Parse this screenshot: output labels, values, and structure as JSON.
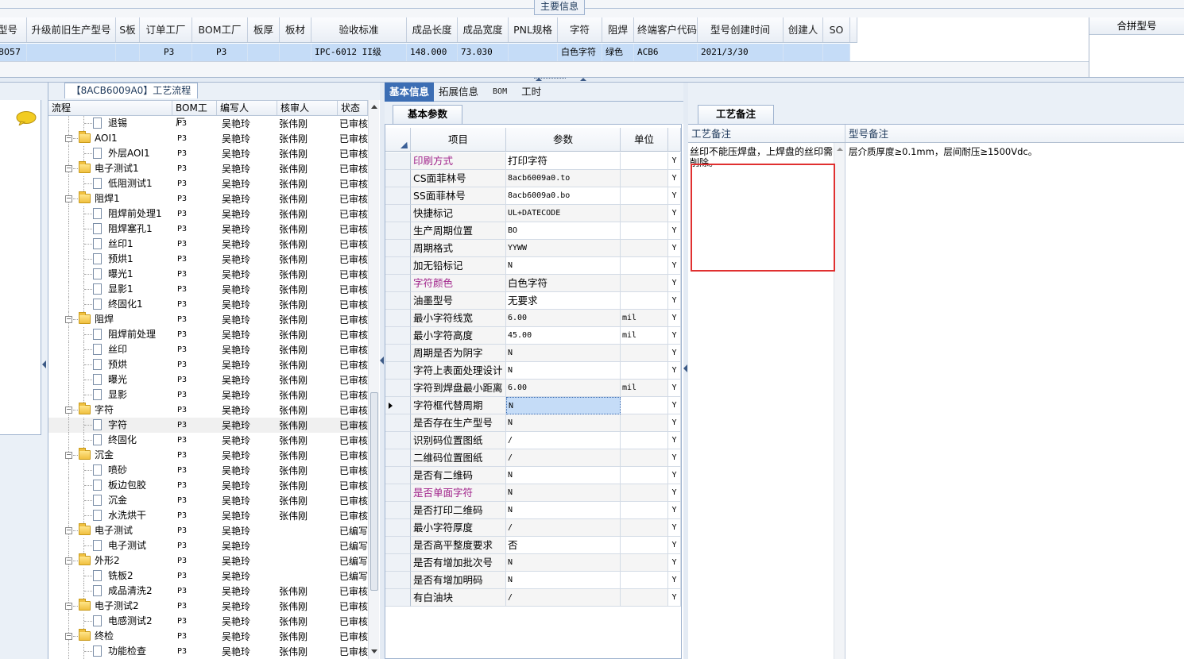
{
  "top": {
    "title": "主要信息",
    "columns": [
      "型号",
      "升级前旧生产型号",
      "S板",
      "订单工厂",
      "BOM工厂",
      "板厚",
      "板材",
      "验收标准",
      "成品长度",
      "成品宽度",
      "PNL规格",
      "字符",
      "阻焊",
      "终端客户代码",
      "型号创建时间",
      "创建人",
      "SO"
    ],
    "row": [
      "8057",
      "",
      "",
      "P3",
      "P3",
      "",
      "",
      "IPC-6012 II级",
      "148.000",
      "73.030",
      "",
      "白色字符",
      "绿色",
      "ACB6",
      "2021/3/30",
      "",
      ""
    ],
    "merge_header": "合拼型号"
  },
  "tree": {
    "title": "【8ACB6009A0】工艺流程",
    "columns": [
      "流程",
      "BOM工厂",
      "编写人",
      "核审人",
      "状态"
    ],
    "rows": [
      {
        "level": 1,
        "type": "doc",
        "name": "退锡",
        "factory": "P3",
        "writer": "吴艳玲",
        "reviewer": "张伟刚",
        "status": "已审核"
      },
      {
        "level": 0,
        "type": "folder",
        "name": "AOI1",
        "factory": "P3",
        "writer": "吴艳玲",
        "reviewer": "张伟刚",
        "status": "已审核"
      },
      {
        "level": 1,
        "type": "doc",
        "name": "外层AOI1",
        "factory": "P3",
        "writer": "吴艳玲",
        "reviewer": "张伟刚",
        "status": "已审核"
      },
      {
        "level": 0,
        "type": "folder",
        "name": "电子测试1",
        "factory": "P3",
        "writer": "吴艳玲",
        "reviewer": "张伟刚",
        "status": "已审核"
      },
      {
        "level": 1,
        "type": "doc",
        "name": "低阻测试1",
        "factory": "P3",
        "writer": "吴艳玲",
        "reviewer": "张伟刚",
        "status": "已审核"
      },
      {
        "level": 0,
        "type": "folder",
        "name": "阻焊1",
        "factory": "P3",
        "writer": "吴艳玲",
        "reviewer": "张伟刚",
        "status": "已审核"
      },
      {
        "level": 1,
        "type": "doc",
        "name": "阻焊前处理1",
        "factory": "P3",
        "writer": "吴艳玲",
        "reviewer": "张伟刚",
        "status": "已审核"
      },
      {
        "level": 1,
        "type": "doc",
        "name": "阻焊塞孔1",
        "factory": "P3",
        "writer": "吴艳玲",
        "reviewer": "张伟刚",
        "status": "已审核"
      },
      {
        "level": 1,
        "type": "doc",
        "name": "丝印1",
        "factory": "P3",
        "writer": "吴艳玲",
        "reviewer": "张伟刚",
        "status": "已审核"
      },
      {
        "level": 1,
        "type": "doc",
        "name": "预烘1",
        "factory": "P3",
        "writer": "吴艳玲",
        "reviewer": "张伟刚",
        "status": "已审核"
      },
      {
        "level": 1,
        "type": "doc",
        "name": "曝光1",
        "factory": "P3",
        "writer": "吴艳玲",
        "reviewer": "张伟刚",
        "status": "已审核"
      },
      {
        "level": 1,
        "type": "doc",
        "name": "显影1",
        "factory": "P3",
        "writer": "吴艳玲",
        "reviewer": "张伟刚",
        "status": "已审核"
      },
      {
        "level": 1,
        "type": "doc",
        "name": "终固化1",
        "factory": "P3",
        "writer": "吴艳玲",
        "reviewer": "张伟刚",
        "status": "已审核"
      },
      {
        "level": 0,
        "type": "folder",
        "name": "阻焊",
        "factory": "P3",
        "writer": "吴艳玲",
        "reviewer": "张伟刚",
        "status": "已审核"
      },
      {
        "level": 1,
        "type": "doc",
        "name": "阻焊前处理",
        "factory": "P3",
        "writer": "吴艳玲",
        "reviewer": "张伟刚",
        "status": "已审核"
      },
      {
        "level": 1,
        "type": "doc",
        "name": "丝印",
        "factory": "P3",
        "writer": "吴艳玲",
        "reviewer": "张伟刚",
        "status": "已审核"
      },
      {
        "level": 1,
        "type": "doc",
        "name": "预烘",
        "factory": "P3",
        "writer": "吴艳玲",
        "reviewer": "张伟刚",
        "status": "已审核"
      },
      {
        "level": 1,
        "type": "doc",
        "name": "曝光",
        "factory": "P3",
        "writer": "吴艳玲",
        "reviewer": "张伟刚",
        "status": "已审核"
      },
      {
        "level": 1,
        "type": "doc",
        "name": "显影",
        "factory": "P3",
        "writer": "吴艳玲",
        "reviewer": "张伟刚",
        "status": "已审核"
      },
      {
        "level": 0,
        "type": "folder",
        "name": "字符",
        "factory": "P3",
        "writer": "吴艳玲",
        "reviewer": "张伟刚",
        "status": "已审核"
      },
      {
        "level": 1,
        "type": "doc",
        "name": "字符",
        "factory": "P3",
        "writer": "吴艳玲",
        "reviewer": "张伟刚",
        "status": "已审核",
        "selected": true
      },
      {
        "level": 1,
        "type": "doc",
        "name": "终固化",
        "factory": "P3",
        "writer": "吴艳玲",
        "reviewer": "张伟刚",
        "status": "已审核"
      },
      {
        "level": 0,
        "type": "folder",
        "name": "沉金",
        "factory": "P3",
        "writer": "吴艳玲",
        "reviewer": "张伟刚",
        "status": "已审核"
      },
      {
        "level": 1,
        "type": "doc",
        "name": "喷砂",
        "factory": "P3",
        "writer": "吴艳玲",
        "reviewer": "张伟刚",
        "status": "已审核"
      },
      {
        "level": 1,
        "type": "doc",
        "name": "板边包胶",
        "factory": "P3",
        "writer": "吴艳玲",
        "reviewer": "张伟刚",
        "status": "已审核"
      },
      {
        "level": 1,
        "type": "doc",
        "name": "沉金",
        "factory": "P3",
        "writer": "吴艳玲",
        "reviewer": "张伟刚",
        "status": "已审核"
      },
      {
        "level": 1,
        "type": "doc",
        "name": "水洗烘干",
        "factory": "P3",
        "writer": "吴艳玲",
        "reviewer": "张伟刚",
        "status": "已审核"
      },
      {
        "level": 0,
        "type": "folder",
        "name": "电子测试",
        "factory": "P3",
        "writer": "吴艳玲",
        "reviewer": "",
        "status": "已编写"
      },
      {
        "level": 1,
        "type": "doc",
        "name": "电子测试",
        "factory": "P3",
        "writer": "吴艳玲",
        "reviewer": "",
        "status": "已编写"
      },
      {
        "level": 0,
        "type": "folder",
        "name": "外形2",
        "factory": "P3",
        "writer": "吴艳玲",
        "reviewer": "",
        "status": "已编写"
      },
      {
        "level": 1,
        "type": "doc",
        "name": "铣板2",
        "factory": "P3",
        "writer": "吴艳玲",
        "reviewer": "",
        "status": "已编写"
      },
      {
        "level": 1,
        "type": "doc",
        "name": "成品清洗2",
        "factory": "P3",
        "writer": "吴艳玲",
        "reviewer": "张伟刚",
        "status": "已审核"
      },
      {
        "level": 0,
        "type": "folder",
        "name": "电子测试2",
        "factory": "P3",
        "writer": "吴艳玲",
        "reviewer": "张伟刚",
        "status": "已审核"
      },
      {
        "level": 1,
        "type": "doc",
        "name": "电感测试2",
        "factory": "P3",
        "writer": "吴艳玲",
        "reviewer": "张伟刚",
        "status": "已审核"
      },
      {
        "level": 0,
        "type": "folder",
        "name": "终检",
        "factory": "P3",
        "writer": "吴艳玲",
        "reviewer": "张伟刚",
        "status": "已审核"
      },
      {
        "level": 1,
        "type": "doc",
        "name": "功能检查",
        "factory": "P3",
        "writer": "吴艳玲",
        "reviewer": "张伟刚",
        "status": "已审核"
      }
    ]
  },
  "mid": {
    "tabs": [
      "基本信息",
      "拓展信息",
      "BOM",
      "工时"
    ],
    "active_tab": 0,
    "subtab": "基本参数",
    "columns": [
      "项目",
      "参数",
      "单位"
    ],
    "rows": [
      {
        "item": "印刷方式",
        "value": "打印字符",
        "unit": "",
        "flag": "Y",
        "highlight": true
      },
      {
        "item": "CS面菲林号",
        "value": "8acb6009a0.to",
        "unit": "",
        "flag": "Y"
      },
      {
        "item": "SS面菲林号",
        "value": "8acb6009a0.bo",
        "unit": "",
        "flag": "Y"
      },
      {
        "item": "快捷标记",
        "value": "UL+DATECODE",
        "unit": "",
        "flag": "Y"
      },
      {
        "item": "生产周期位置",
        "value": "BO",
        "unit": "",
        "flag": "Y"
      },
      {
        "item": "周期格式",
        "value": "YYWW",
        "unit": "",
        "flag": "Y"
      },
      {
        "item": "加无铅标记",
        "value": "N",
        "unit": "",
        "flag": "Y"
      },
      {
        "item": "字符颜色",
        "value": "白色字符",
        "unit": "",
        "flag": "Y",
        "highlight": true
      },
      {
        "item": "油墨型号",
        "value": "无要求",
        "unit": "",
        "flag": "Y"
      },
      {
        "item": "最小字符线宽",
        "value": "6.00",
        "unit": "mil",
        "flag": "Y"
      },
      {
        "item": "最小字符高度",
        "value": "45.00",
        "unit": "mil",
        "flag": "Y"
      },
      {
        "item": "周期是否为阴字",
        "value": "N",
        "unit": "",
        "flag": "Y"
      },
      {
        "item": "字符上表面处理设计",
        "value": "N",
        "unit": "",
        "flag": "Y"
      },
      {
        "item": "字符到焊盘最小距离",
        "value": "6.00",
        "unit": "mil",
        "flag": "Y"
      },
      {
        "item": "字符框代替周期",
        "value": "N",
        "unit": "",
        "flag": "Y",
        "current": true
      },
      {
        "item": "是否存在生产型号",
        "value": "N",
        "unit": "",
        "flag": "Y"
      },
      {
        "item": "识别码位置图纸",
        "value": "/",
        "unit": "",
        "flag": "Y"
      },
      {
        "item": "二维码位置图纸",
        "value": "/",
        "unit": "",
        "flag": "Y"
      },
      {
        "item": "是否有二维码",
        "value": "N",
        "unit": "",
        "flag": "Y"
      },
      {
        "item": "是否单面字符",
        "value": "N",
        "unit": "",
        "flag": "Y",
        "highlight": true
      },
      {
        "item": "是否打印二维码",
        "value": "N",
        "unit": "",
        "flag": "Y"
      },
      {
        "item": "最小字符厚度",
        "value": "/",
        "unit": "",
        "flag": "Y"
      },
      {
        "item": "是否高平整度要求",
        "value": "否",
        "unit": "",
        "flag": "Y"
      },
      {
        "item": "是否有增加批次号",
        "value": "N",
        "unit": "",
        "flag": "Y"
      },
      {
        "item": "是否有增加明码",
        "value": "N",
        "unit": "",
        "flag": "Y"
      },
      {
        "item": "有白油块",
        "value": "/",
        "unit": "",
        "flag": "Y"
      }
    ]
  },
  "right": {
    "tab": "工艺备注",
    "col_craft": "工艺备注",
    "col_model": "型号备注",
    "craft_note": "丝印不能压焊盘，上焊盘的丝印需削除。",
    "model_note": "层介质厚度≥0.1mm，层间耐压≥1500Vdc。"
  },
  "colors": {
    "accent": "#3c6eb4",
    "selection": "#c5dcf7",
    "highlight_text": "#a0228a",
    "annotation_box": "#e03030"
  }
}
